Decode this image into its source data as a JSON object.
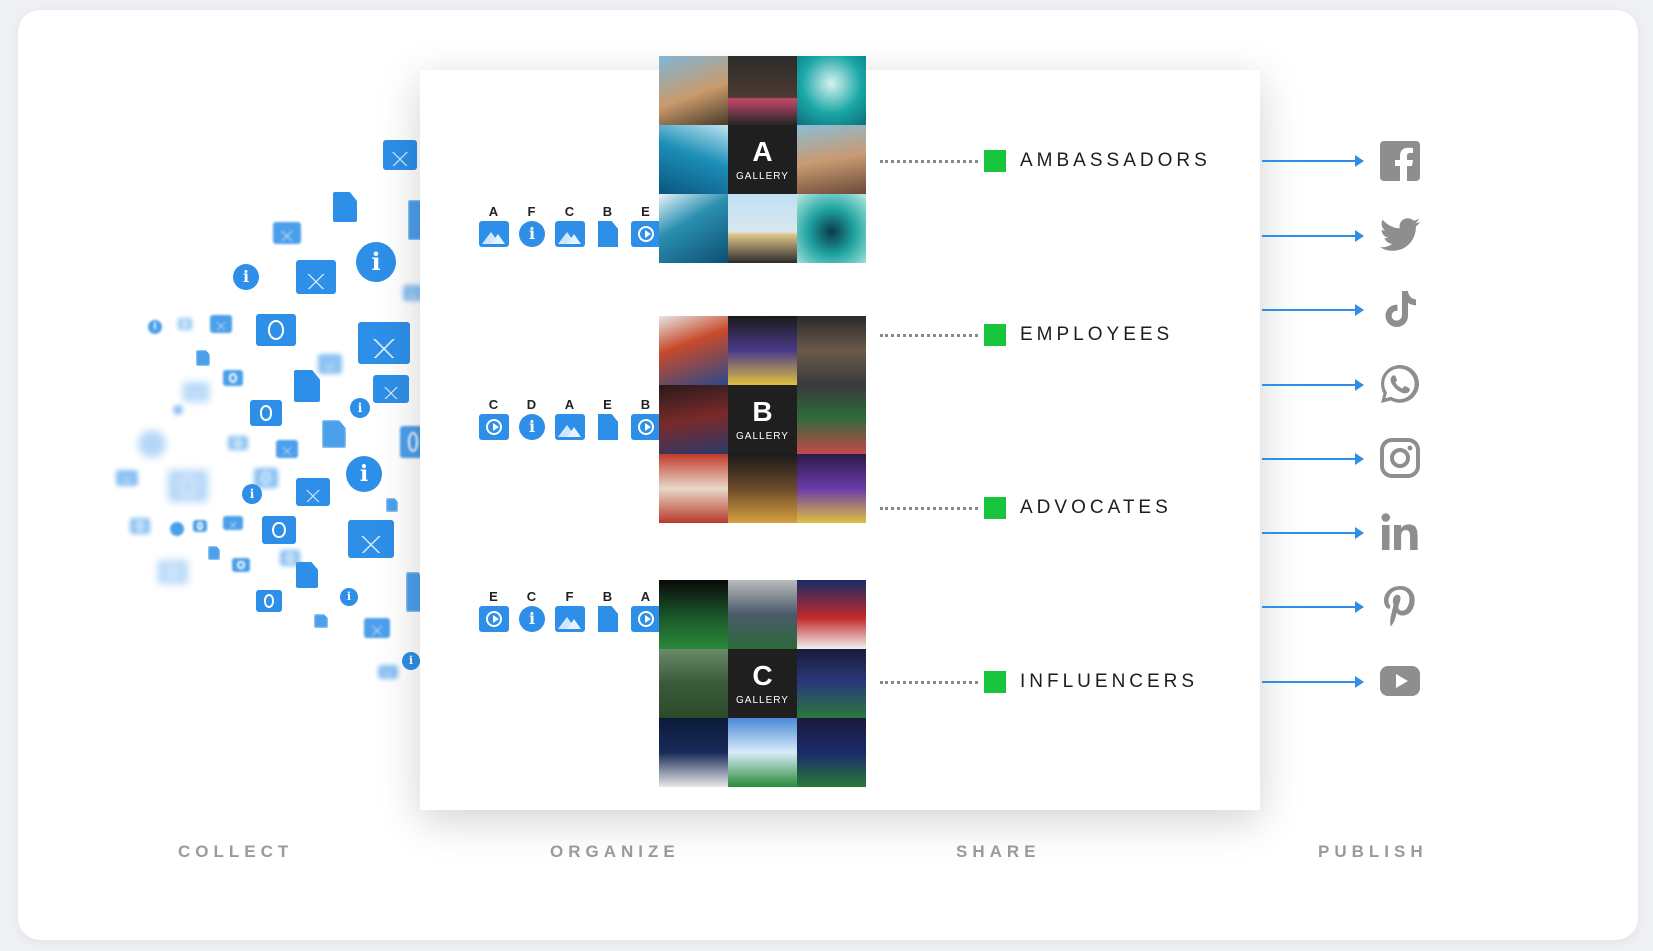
{
  "steps": {
    "collect": "COLLECT",
    "organize": "ORGANIZE",
    "share": "SHARE",
    "publish": "PUBLISH"
  },
  "rows": [
    {
      "letters": [
        "A",
        "F",
        "C",
        "B",
        "E"
      ],
      "icons": [
        "image-icon",
        "info-icon",
        "image-icon",
        "document-icon",
        "video-icon"
      ],
      "gallery": {
        "letter": "A",
        "word": "GALLERY"
      }
    },
    {
      "letters": [
        "C",
        "D",
        "A",
        "E",
        "B"
      ],
      "icons": [
        "video-icon",
        "info-icon",
        "image-icon",
        "document-icon",
        "video-icon"
      ],
      "gallery": {
        "letter": "B",
        "word": "GALLERY"
      }
    },
    {
      "letters": [
        "E",
        "C",
        "F",
        "B",
        "A"
      ],
      "icons": [
        "video-icon",
        "info-icon",
        "image-icon",
        "document-icon",
        "video-icon"
      ],
      "gallery": {
        "letter": "C",
        "word": "GALLERY"
      }
    }
  ],
  "audiences": [
    "AMBASSADORS",
    "EMPLOYEES",
    "ADVOCATES",
    "INFLUENCERS"
  ],
  "platforms": [
    "facebook-icon",
    "twitter-icon",
    "tiktok-icon",
    "whatsapp-icon",
    "instagram-icon",
    "linkedin-icon",
    "pinterest-icon",
    "youtube-icon"
  ],
  "colors": {
    "accent_blue": "#2d8fe8",
    "audience_green": "#17c43c",
    "platform_gray": "#8e8e8e"
  }
}
